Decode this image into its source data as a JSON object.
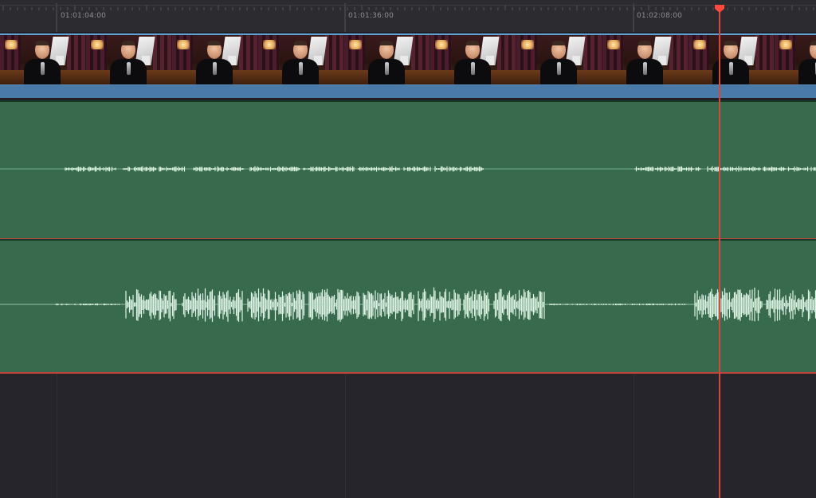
{
  "ruler": {
    "timecodes": [
      "01:01:04:00",
      "01:01:36:00",
      "01:02:08:00"
    ]
  },
  "video_track": {
    "clip_color": "#4a7aa8",
    "thumbnail_count": 10
  },
  "audio_tracks": [
    {
      "name": "audio-track-1",
      "color": "#386b4e",
      "waveform": "low-level"
    },
    {
      "name": "audio-track-2",
      "color": "#386b4e",
      "waveform": "high-level"
    }
  ],
  "playhead": {
    "color": "#d8483c"
  },
  "colors": {
    "background": "#25252b",
    "ruler": "#2b2b30",
    "waveform": "#dff5e6",
    "clip_border_red": "#c0443a"
  }
}
